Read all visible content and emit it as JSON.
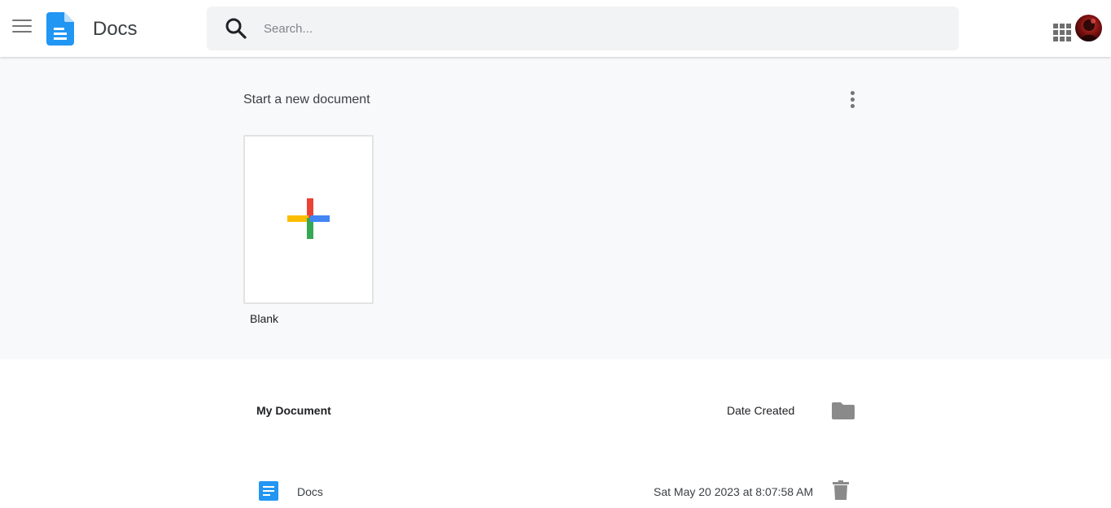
{
  "header": {
    "app_title": "Docs",
    "search_placeholder": "Search...",
    "search_value": ""
  },
  "templates": {
    "title": "Start a new document",
    "blank_label": "Blank"
  },
  "documents": {
    "header_title": "My Document",
    "header_date": "Date Created",
    "rows": [
      {
        "name": "Docs",
        "date": "Sat May 20 2023 at 8:07:58 AM"
      }
    ]
  },
  "icons": {
    "menu": "menu-icon",
    "logo": "docs-logo-icon",
    "search": "search-icon",
    "apps": "apps-grid-icon",
    "more": "more-vert-icon",
    "plus": "plus-icon",
    "folder": "folder-icon",
    "doc": "document-icon",
    "trash": "trash-icon"
  },
  "colors": {
    "brand_blue": "#2196f3",
    "plus_red": "#ea4335",
    "plus_blue": "#4285f4",
    "plus_green": "#34a853",
    "plus_yellow": "#fbbc04",
    "icon_gray": "#8a8a8a",
    "panel_bg": "#f8f9fa"
  }
}
